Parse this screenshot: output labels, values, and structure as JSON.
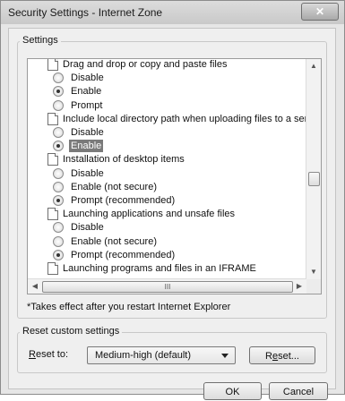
{
  "window": {
    "title": "Security Settings - Internet Zone",
    "close_glyph": "✕"
  },
  "settings_group": {
    "label": "Settings",
    "items": [
      {
        "type": "category",
        "label": "Drag and drop or copy and paste files"
      },
      {
        "type": "option",
        "label": "Disable",
        "checked": false,
        "selected": false
      },
      {
        "type": "option",
        "label": "Enable",
        "checked": true,
        "selected": false
      },
      {
        "type": "option",
        "label": "Prompt",
        "checked": false,
        "selected": false
      },
      {
        "type": "category",
        "label": "Include local directory path when uploading files to a server"
      },
      {
        "type": "option",
        "label": "Disable",
        "checked": false,
        "selected": false
      },
      {
        "type": "option",
        "label": "Enable",
        "checked": true,
        "selected": true
      },
      {
        "type": "category",
        "label": "Installation of desktop items"
      },
      {
        "type": "option",
        "label": "Disable",
        "checked": false,
        "selected": false
      },
      {
        "type": "option",
        "label": "Enable (not secure)",
        "checked": false,
        "selected": false
      },
      {
        "type": "option",
        "label": "Prompt (recommended)",
        "checked": true,
        "selected": false
      },
      {
        "type": "category",
        "label": "Launching applications and unsafe files"
      },
      {
        "type": "option",
        "label": "Disable",
        "checked": false,
        "selected": false
      },
      {
        "type": "option",
        "label": "Enable (not secure)",
        "checked": false,
        "selected": false
      },
      {
        "type": "option",
        "label": "Prompt (recommended)",
        "checked": true,
        "selected": false
      },
      {
        "type": "category",
        "label": "Launching programs and files in an IFRAME"
      }
    ],
    "scroll_up_glyph": "▲",
    "scroll_down_glyph": "▼",
    "scroll_left_glyph": "◀",
    "scroll_right_glyph": "▶",
    "h_thumb_grip": "III"
  },
  "note": "*Takes effect after you restart Internet Explorer",
  "reset_group": {
    "label": "Reset custom settings",
    "reset_to_label_prefix": "",
    "reset_to_mnemonic": "R",
    "reset_to_label_rest": "eset to:",
    "dropdown_value": "Medium-high (default)",
    "reset_button_prefix": "R",
    "reset_button_mnemonic": "e",
    "reset_button_rest": "set..."
  },
  "buttons": {
    "ok": "OK",
    "cancel": "Cancel"
  }
}
